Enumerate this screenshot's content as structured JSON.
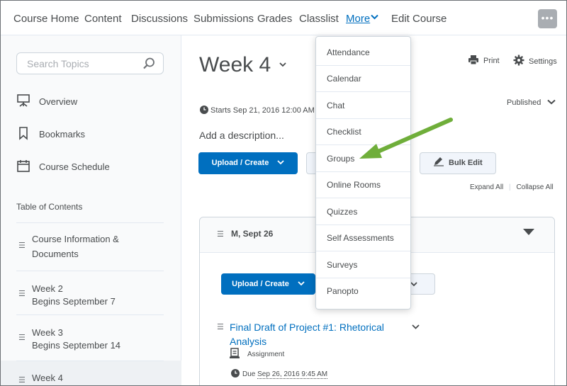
{
  "topnav": {
    "items": [
      "Course Home",
      "Content",
      "Discussions",
      "Submissions",
      "Grades",
      "Classlist"
    ],
    "more_label": "More",
    "edit_label": "Edit Course",
    "options_glyph": "•••"
  },
  "more_menu": [
    "Attendance",
    "Calendar",
    "Chat",
    "Checklist",
    "Groups",
    "Online Rooms",
    "Quizzes",
    "Self Assessments",
    "Surveys",
    "Panopto"
  ],
  "left_panel": {
    "search_placeholder": "Search Topics",
    "nav": [
      {
        "label": "Overview",
        "icon": "presentation-icon"
      },
      {
        "label": "Bookmarks",
        "icon": "bookmark-icon"
      },
      {
        "label": "Course Schedule",
        "icon": "calendar-icon"
      }
    ],
    "toc_heading": "Table of Contents",
    "toc": [
      {
        "title": "Course Information & Documents",
        "subtitle": ""
      },
      {
        "title": "Week 2",
        "subtitle": "Begins September 7"
      },
      {
        "title": "Week 3",
        "subtitle": "Begins September 14"
      },
      {
        "title": "Week 4",
        "subtitle": ""
      }
    ]
  },
  "main": {
    "title": "Week 4",
    "print_label": "Print",
    "settings_label": "Settings",
    "published_label": "Published",
    "starts": "Starts Sep 21, 2016 12:00 AM",
    "add_description": "Add a description...",
    "upload_create": "Upload / Create",
    "bulk_edit": "Bulk Edit",
    "expand_all": "Expand All",
    "collapse_all": "Collapse All",
    "module": {
      "title": "M, Sept 26",
      "upload_create": "Upload / Create",
      "topic": {
        "title": "Final Draft of Project #1: Rhetorical Analysis",
        "type": "Assignment",
        "due_prefix": "Due",
        "due_date": "Sep 26, 2016 9:45 AM"
      }
    }
  },
  "colors": {
    "link": "#006fbf",
    "primary_button": "#006fbf",
    "arrow": "#6fae3a"
  }
}
